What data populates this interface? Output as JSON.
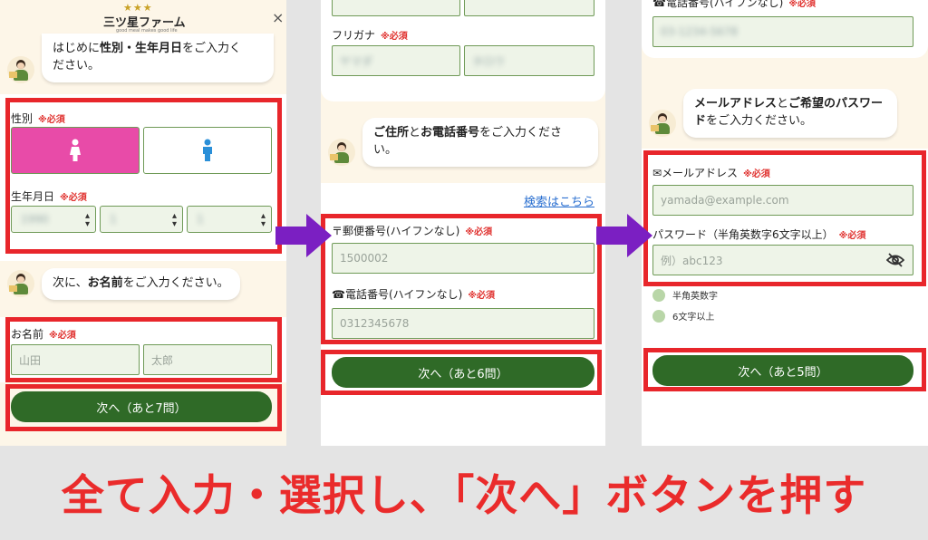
{
  "panel1": {
    "brand": {
      "stars": "★★★",
      "name": "三ツ星ファーム",
      "tagline": "good meal makes good life"
    },
    "close": "×",
    "bubble1": {
      "pre": "はじめに",
      "bold1": "性別・生年月日",
      "post": "をご入力く",
      "line2": "ださい。"
    },
    "gender": {
      "label": "性別",
      "req": "※必須",
      "female_icon": "female-icon",
      "male_icon": "male-icon",
      "selected": "female"
    },
    "birth": {
      "label": "生年月日",
      "req": "※必須",
      "year": "1990",
      "month": "1",
      "day": "1"
    },
    "bubble2": {
      "pre": "次に、",
      "bold": "お名前",
      "post": "をご入力ください。"
    },
    "name": {
      "label": "お名前",
      "req": "※必須",
      "last_placeholder": "山田",
      "first_placeholder": "太郎"
    },
    "next_button": "次へ（あと7問）"
  },
  "panel2": {
    "furigana": {
      "label": "フリガナ",
      "req": "※必須",
      "last_value": "ヤマダ",
      "first_value": "タロウ"
    },
    "bubble": {
      "bold1": "ご住所",
      "mid": "と",
      "bold2": "お電話番号",
      "post": "をご入力くださ",
      "line2": "い。"
    },
    "search_link": "検索はこちら",
    "postal": {
      "label": "〒郵便番号(ハイフンなし)",
      "req": "※必須",
      "placeholder": "1500002"
    },
    "phone": {
      "label": "☎電話番号(ハイフンなし)",
      "req": "※必須",
      "placeholder": "0312345678"
    },
    "next_button": "次へ（あと6問）"
  },
  "panel3": {
    "phone_label_partial": "☎電話番号(ハイフンなし)",
    "phone_req_partial": "※必須",
    "phone_value": "03-1234-5678",
    "bubble": {
      "bold1": "メールアドレス",
      "mid": "と",
      "bold2": "ご希望のパスワー",
      "line2_bold": "ド",
      "line2_post": "をご入力ください。"
    },
    "email": {
      "label": "✉メールアドレス",
      "req": "※必須",
      "placeholder": "yamada@example.com"
    },
    "password": {
      "label": "パスワード（半角英数字6文字以上）",
      "req": "※必須",
      "placeholder": "例）abc123",
      "toggle_icon": "eye-slash-icon"
    },
    "rules": [
      "半角英数字",
      "6文字以上"
    ],
    "next_button": "次へ（あと5問）"
  },
  "caption": "全て入力・選択し、「次へ」ボタンを押す",
  "colors": {
    "highlight": "#e8262b",
    "arrow": "#7b1fc2",
    "button": "#2f6a27",
    "selected_gender": "#e84ba8",
    "caption": "#ea2b2b"
  }
}
